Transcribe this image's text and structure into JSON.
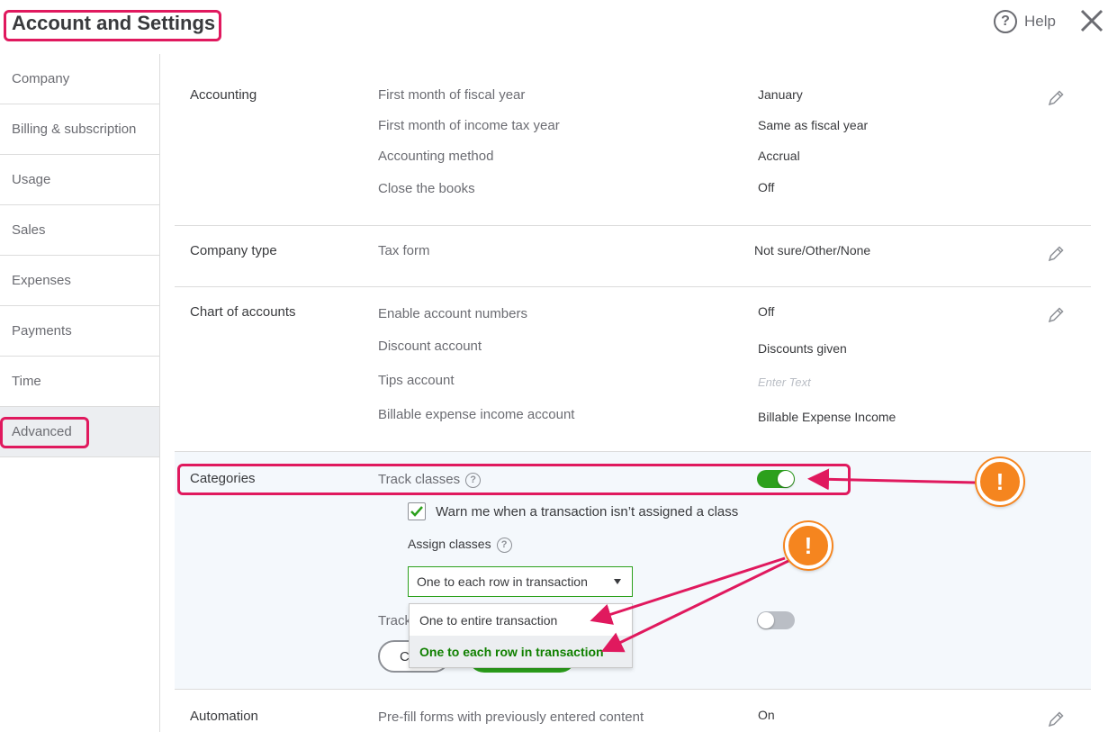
{
  "header": {
    "title": "Account and Settings",
    "help_label": "Help"
  },
  "sidebar": {
    "items": [
      {
        "label": "Company"
      },
      {
        "label": "Billing & subscription"
      },
      {
        "label": "Usage"
      },
      {
        "label": "Sales"
      },
      {
        "label": "Expenses"
      },
      {
        "label": "Payments"
      },
      {
        "label": "Time"
      },
      {
        "label": "Advanced"
      }
    ]
  },
  "accounting": {
    "label": "Accounting",
    "rows": [
      {
        "label": "First month of fiscal year",
        "value": "January"
      },
      {
        "label": "First month of income tax year",
        "value": "Same as fiscal year"
      },
      {
        "label": "Accounting method",
        "value": "Accrual"
      },
      {
        "label": "Close the books",
        "value": "Off"
      }
    ]
  },
  "company_type": {
    "label": "Company type",
    "rows": [
      {
        "label": "Tax form",
        "value": "Not sure/Other/None"
      }
    ]
  },
  "chart_of_accounts": {
    "label": "Chart of accounts",
    "rows": [
      {
        "label": "Enable account numbers",
        "value": "Off"
      },
      {
        "label": "Discount account",
        "value": "Discounts given"
      },
      {
        "label": "Tips account",
        "placeholder": "Enter Text"
      },
      {
        "label": "Billable expense income account",
        "value": "Billable Expense Income"
      }
    ]
  },
  "categories": {
    "label": "Categories",
    "track_classes": {
      "label": "Track classes",
      "on": true
    },
    "warn_checkbox": {
      "label": "Warn me when a transaction isn’t assigned a class",
      "checked": true
    },
    "assign_classes": {
      "label": "Assign classes",
      "selected": "One to each row in transaction",
      "options": [
        "One to entire transaction",
        "One to each row in transaction"
      ]
    },
    "track_locations": {
      "label_visible": "Track",
      "on": false
    },
    "cancel_label_visible": "C"
  },
  "automation": {
    "label": "Automation",
    "rows": [
      {
        "label": "Pre-fill forms with previously entered content",
        "value": "On"
      }
    ]
  },
  "annotation": {
    "warning_glyph": "!",
    "highlight_color": "#e0195e",
    "warning_color": "#f5851f"
  },
  "colors": {
    "green": "#2ca01c",
    "dark_green": "#108000",
    "text": "#393a3d",
    "muted": "#6b6c72"
  }
}
